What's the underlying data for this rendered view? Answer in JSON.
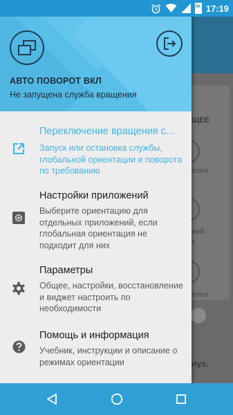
{
  "status_bar": {
    "time": "17:19",
    "battery_level": "96",
    "icons": [
      "alarm-icon",
      "wifi-icon",
      "signal-icon",
      "battery-icon"
    ]
  },
  "background": {
    "fragments": [
      "ЩЕЕ",
      "ельн",
      "ией",
      "т",
      "ельн",
      "луз."
    ]
  },
  "drawer": {
    "header": {
      "title": "АВТО ПОВОРОТ ВКЛ",
      "subtitle": "Не запущена служба вращения"
    },
    "items": [
      {
        "title": "Переключение вращения с...",
        "description": "Запуск или остановка службы, глобальной ориентации и поворота по требованию",
        "icon": "open-external-icon",
        "active": true
      },
      {
        "title": "Настройки приложений",
        "description": "Выберите ориентацию для отдельных приложений, если глобальная ориентация не подходит для них",
        "icon": "app-settings-icon",
        "active": false
      },
      {
        "title": "Параметры",
        "description": "Общее, настройки, восстановление и виджет настроить по необходимости",
        "icon": "gear-icon",
        "active": false
      },
      {
        "title": "Помощь и информация",
        "description": "Учебник, инструкции и описание о режимах ориентации",
        "icon": "help-icon",
        "active": false
      }
    ]
  },
  "colors": {
    "accent": "#44b3e6",
    "header": "#58bfe9",
    "status_bar": "#2196d3",
    "nav_bar": "#2f9fd6"
  }
}
